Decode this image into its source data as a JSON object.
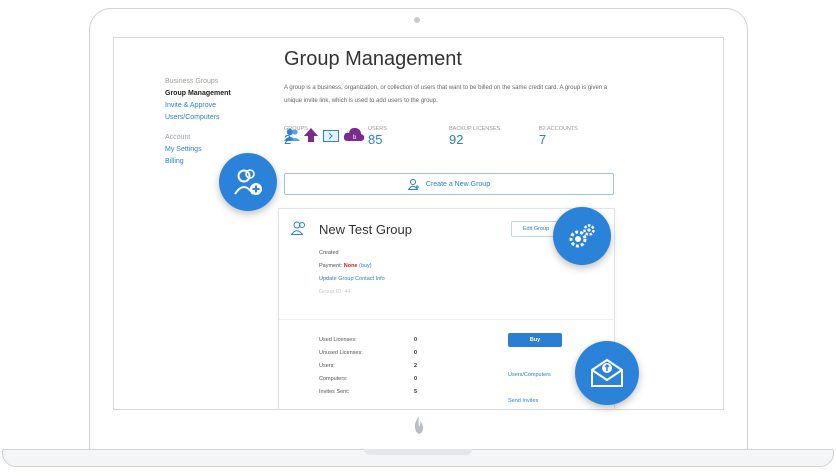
{
  "sidebar": {
    "section_business": "Business Groups",
    "items_business": [
      {
        "label": "Group Management",
        "active": true
      },
      {
        "label": "Invite & Approve",
        "active": false
      },
      {
        "label": "Users/Computers",
        "active": false
      }
    ],
    "section_account": "Account",
    "items_account": [
      {
        "label": "My Settings"
      },
      {
        "label": "Billing"
      }
    ]
  },
  "main": {
    "title": "Group Management",
    "description": "A group is a business, organization, or collection of users that want to be billed on the same credit card. A group is given a unique invite link, which is used to add users to the group.",
    "stats": [
      {
        "label": "GROUPS",
        "value": "2"
      },
      {
        "label": "USERS",
        "value": "85",
        "icon": "users-icon"
      },
      {
        "label": "BACKUP LICENSES",
        "value": "92",
        "icon": "backup-upload-icon"
      },
      {
        "label": "B2 ACCOUNTS",
        "value": "7",
        "icon": "b2-cloud-icon"
      }
    ],
    "create_label": "Create a New Group"
  },
  "group": {
    "name": "New Test Group",
    "edit_label": "Edit Group",
    "created_label": "Created",
    "payment_prefix": "Payment: ",
    "payment_status": "None",
    "payment_buy": "(buy)",
    "update_link": "Update Group Contact Info",
    "faint_text": "Group ID: 44",
    "rows": [
      {
        "label": "Used Licenses:",
        "value": "0"
      },
      {
        "label": "Unused Licenses:",
        "value": "0"
      },
      {
        "label": "Users:",
        "value": "2"
      },
      {
        "label": "Computers:",
        "value": "0"
      },
      {
        "label": "Invites Sent:",
        "value": "5"
      }
    ],
    "buy_label": "Buy",
    "users_computers_link": "Users/Computers",
    "send_invites_link": "Send Invites"
  },
  "colors": {
    "accent": "#2b82d9",
    "purple": "#7b2a8f",
    "red": "#cc2222"
  }
}
